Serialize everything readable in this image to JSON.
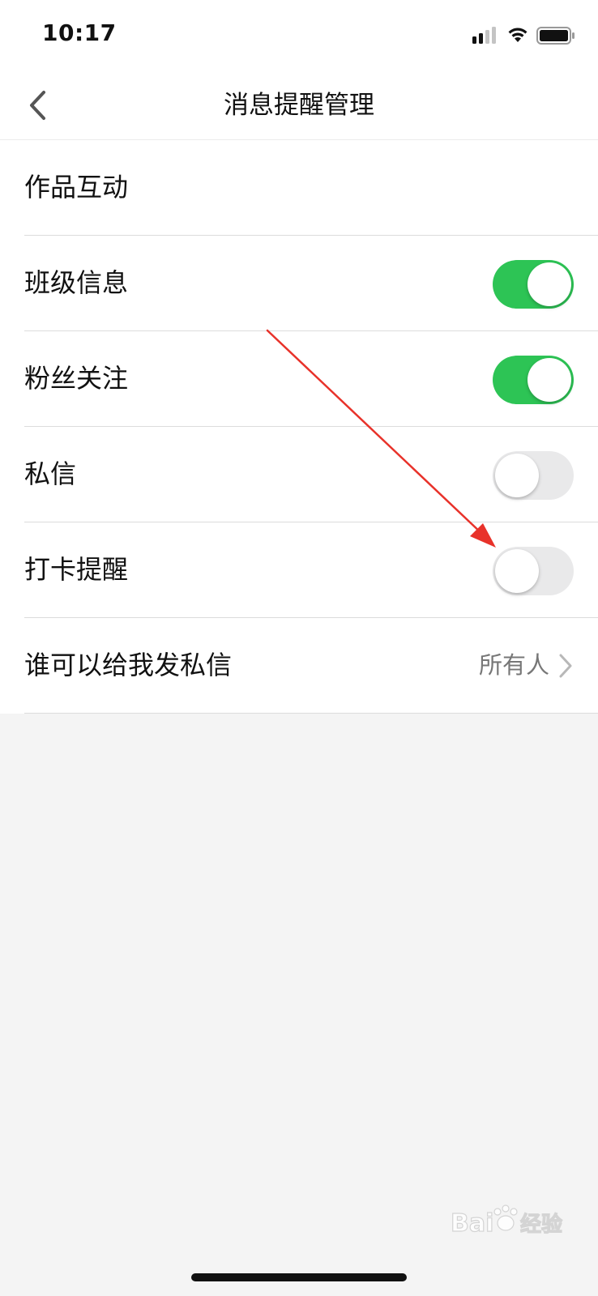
{
  "status_bar": {
    "time": "10:17",
    "signal_icon": "cellular-signal-icon",
    "wifi_icon": "wifi-icon",
    "battery_icon": "battery-icon"
  },
  "nav": {
    "back_icon": "chevron-left-icon",
    "title": "消息提醒管理"
  },
  "settings": {
    "items": [
      {
        "label": "作品互动"
      },
      {
        "label": "班级信息",
        "toggle": true
      },
      {
        "label": "粉丝关注",
        "toggle": true
      },
      {
        "label": "私信",
        "toggle": false
      },
      {
        "label": "打卡提醒",
        "toggle": false
      },
      {
        "label": "谁可以给我发私信",
        "value": "所有人"
      }
    ]
  },
  "colors": {
    "toggle_on": "#2dc455",
    "toggle_off": "#e9e9ea",
    "annotation_arrow": "#e8322a"
  },
  "watermark_text": "Baidu经验"
}
